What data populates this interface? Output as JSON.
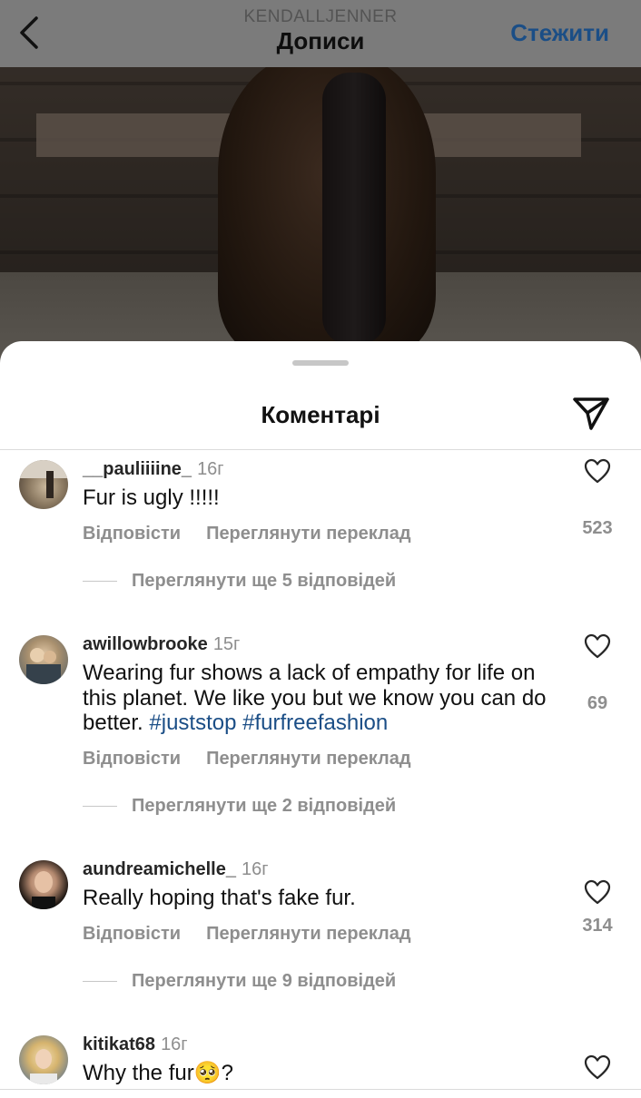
{
  "header": {
    "account": "KENDALLJENNER",
    "title": "Дописи",
    "follow_label": "Стежити"
  },
  "sheet": {
    "title": "Коментарі"
  },
  "comments": [
    {
      "username": "__pauliiiine_",
      "time": "16г",
      "text": "Fur is ugly !!!!!",
      "reply_label": "Відповісти",
      "translate_label": "Переглянути переклад",
      "likes": "523",
      "view_replies": "Переглянути ще 5 відповідей"
    },
    {
      "username": "awillowbrooke",
      "time": "15г",
      "text": "Wearing fur shows a lack of empathy for life on this planet. We like you but we know you can do better.",
      "hashtags": "#juststop #furfreefashion",
      "reply_label": "Відповісти",
      "translate_label": "Переглянути переклад",
      "likes": "69",
      "view_replies": "Переглянути ще 2 відповідей"
    },
    {
      "username": "aundreamichelle_",
      "time": "16г",
      "text": "Really hoping that's fake fur.",
      "reply_label": "Відповісти",
      "translate_label": "Переглянути переклад",
      "likes": "314",
      "view_replies": "Переглянути ще 9 відповідей"
    },
    {
      "username": "kitikat68",
      "time": "16г",
      "text": "Why the fur🥺?"
    }
  ],
  "icons": {
    "back": "chevron-left-icon",
    "send": "paper-plane-icon",
    "like": "heart-outline-icon"
  },
  "colors": {
    "link": "#1b4e86",
    "muted": "#8e8e8e",
    "text": "#111111"
  }
}
